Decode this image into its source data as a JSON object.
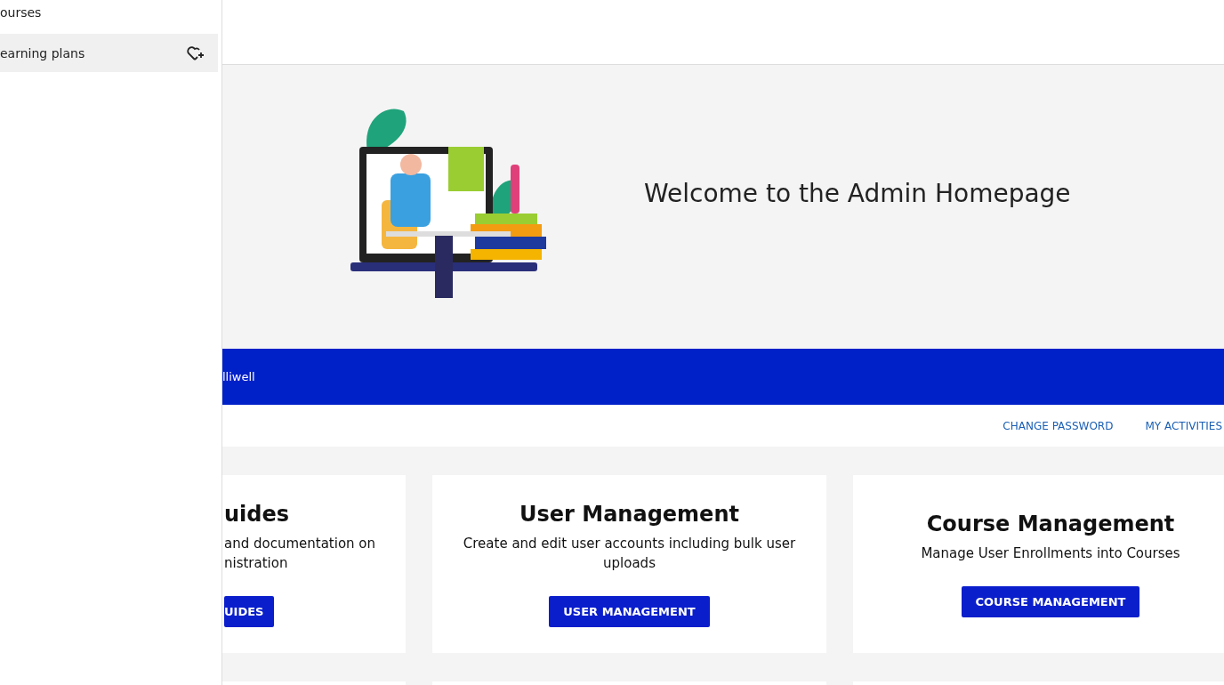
{
  "sidebar": {
    "items": [
      {
        "label": "ourses",
        "selected": false,
        "kind": "plain"
      },
      {
        "label": "earning plans",
        "selected": true,
        "kind": "favorite"
      }
    ]
  },
  "hero": {
    "title": "Welcome to the Admin Homepage"
  },
  "user_bar": {
    "name": "lliwell"
  },
  "links": [
    "CHANGE PASSWORD",
    "MY ACTIVITIES"
  ],
  "cards": [
    {
      "title": "uides",
      "description": "and documentation on\nnistration",
      "button": "UIDES",
      "cut": true
    },
    {
      "title": "User Management",
      "description": "Create and edit user accounts including bulk user uploads",
      "button": "USER MANAGEMENT",
      "cut": false
    },
    {
      "title": "Course Management",
      "description": "Manage User Enrollments into Courses",
      "button": "COURSE MANAGEMENT",
      "cut": false
    }
  ]
}
